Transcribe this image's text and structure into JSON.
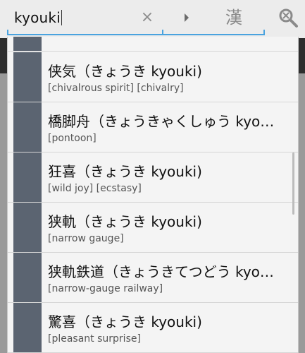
{
  "search": {
    "query": "kyouki",
    "clear_icon": "close-icon",
    "play_icon": "play-icon",
    "kanji_label": "漢",
    "zoom_icon": "zoom-icon"
  },
  "results": [
    {
      "word": "侠気（きょうき kyouki)",
      "gloss": "[chivalrous spirit] [chivalry]"
    },
    {
      "word": "橋脚舟（きょうきゃくしゅう kyo…",
      "gloss": "[pontoon]"
    },
    {
      "word": "狂喜（きょうき kyouki)",
      "gloss": "[wild joy] [ecstasy]"
    },
    {
      "word": "狭軌（きょうき kyouki)",
      "gloss": "[narrow gauge]"
    },
    {
      "word": "狭軌鉄道（きょうきてつどう kyo…",
      "gloss": "[narrow-gauge railway]"
    },
    {
      "word": "驚喜（きょうき kyouki)",
      "gloss": "[pleasant surprise]"
    }
  ],
  "colors": {
    "accent": "#4aa3df",
    "row_bar": "#5b6471"
  }
}
